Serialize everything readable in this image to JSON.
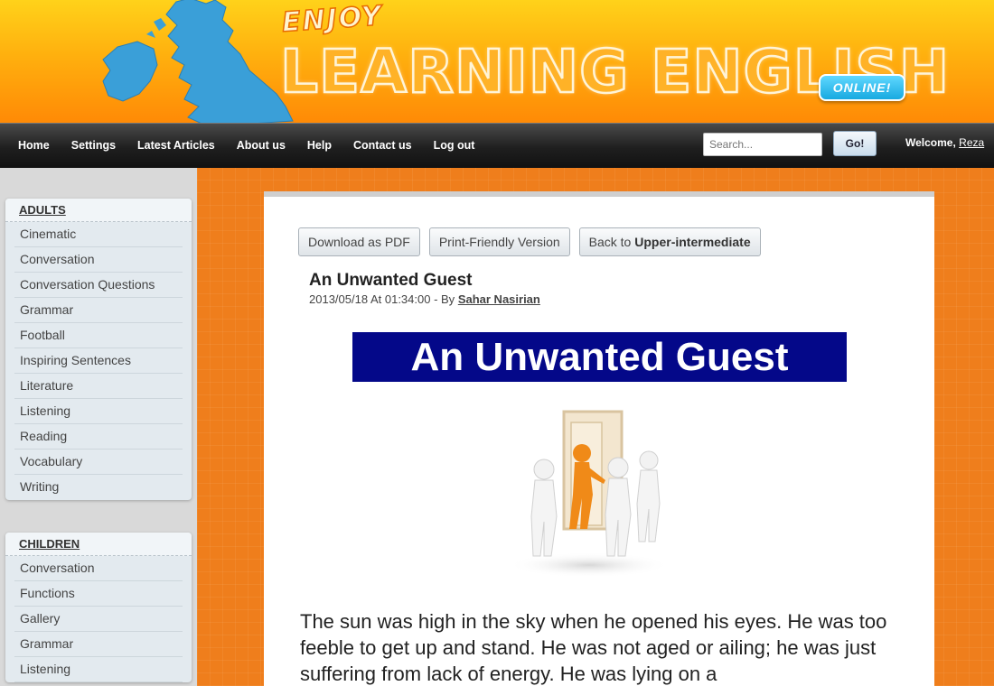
{
  "header": {
    "enjoy": "ENJOY",
    "title": "LEARNING ENGLISH",
    "badge": "ONLINE!",
    "colors": {
      "banner_top": "#ffd21a",
      "banner_bottom": "#ff8a06",
      "map": "#3a9fd8"
    }
  },
  "nav": {
    "items": [
      {
        "label": "Home"
      },
      {
        "label": "Settings"
      },
      {
        "label": "Latest Articles"
      },
      {
        "label": "About us"
      },
      {
        "label": "Help"
      },
      {
        "label": "Contact us"
      },
      {
        "label": "Log out"
      }
    ],
    "search_placeholder": "Search...",
    "go_label": "Go!",
    "welcome_text": "Welcome,",
    "username": "Reza"
  },
  "sidebar": {
    "adults": {
      "heading": "ADULTS",
      "items": [
        "Cinematic",
        "Conversation",
        "Conversation Questions",
        "Grammar",
        "Football",
        "Inspiring Sentences",
        "Literature",
        "Listening",
        "Reading",
        "Vocabulary",
        "Writing"
      ]
    },
    "children": {
      "heading": "CHILDREN",
      "items": [
        "Conversation",
        "Functions",
        "Gallery",
        "Grammar",
        "Listening"
      ]
    }
  },
  "article": {
    "buttons": {
      "pdf": "Download as PDF",
      "print": "Print-Friendly Version",
      "back_prefix": "Back to",
      "back_target": "Upper-intermediate"
    },
    "title": "An Unwanted Guest",
    "date": "2013/05/18 At 01:34:00 - By",
    "author": "Sahar Nasirian",
    "banner_text": "An Unwanted Guest",
    "body": "The sun was high in the sky when he opened his eyes. He was too feeble to get up and stand. He was not aged or ailing; he was just suffering from lack of energy. He was lying on a",
    "colors": {
      "banner_bg": "#040889",
      "page_bg": "#ef7e1c"
    }
  }
}
